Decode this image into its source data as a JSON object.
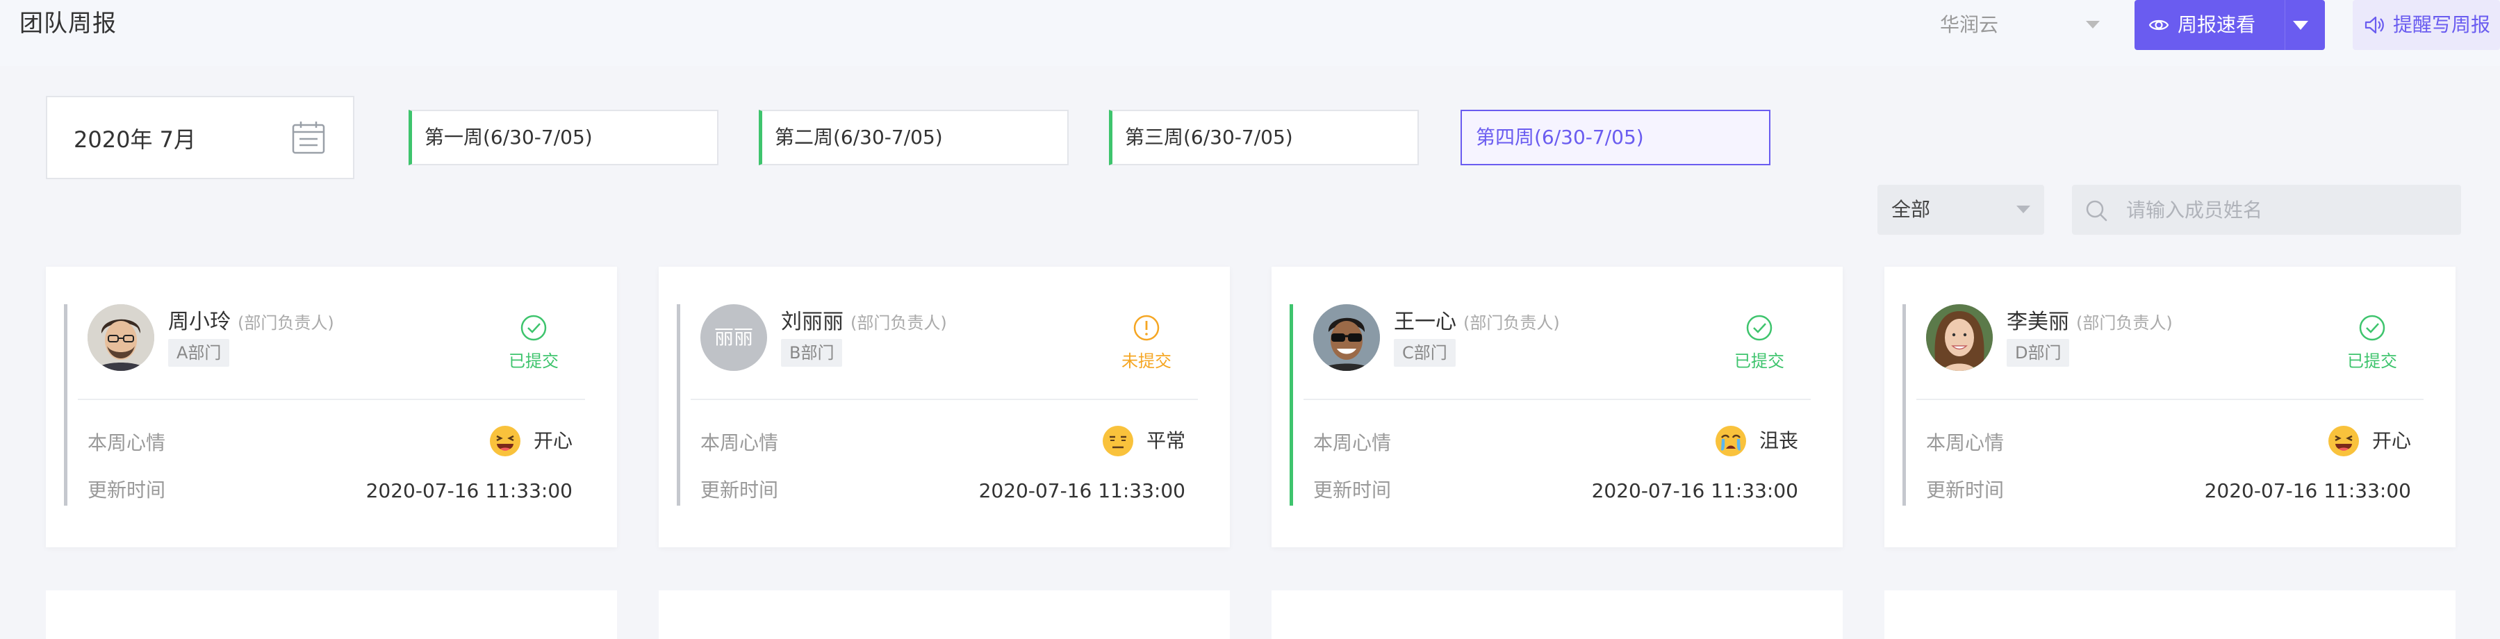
{
  "header": {
    "title": "团队周报",
    "org_select": "华润云",
    "quick_view_label": "周报速看",
    "remind_label": "提醒写周报"
  },
  "month_picker": {
    "value": "2020年   7月"
  },
  "weeks": [
    {
      "label": "第一周(6/30-7/05)",
      "active": false
    },
    {
      "label": "第二周(6/30-7/05)",
      "active": false
    },
    {
      "label": "第三周(6/30-7/05)",
      "active": false
    },
    {
      "label": "第四周(6/30-7/05)",
      "active": true
    }
  ],
  "filters": {
    "scope": "全部",
    "search_placeholder": "请输入成员姓名",
    "search_value": ""
  },
  "labels": {
    "mood": "本周心情",
    "updated": "更新时间"
  },
  "members": [
    {
      "name": "周小玲",
      "role": "(部门负责人)",
      "dept": "A部门",
      "status": "已提交",
      "mood": "开心",
      "updated": "2020-07-16 11:33:00"
    },
    {
      "name": "刘丽丽",
      "role": "(部门负责人)",
      "dept": "B部门",
      "status": "未提交",
      "avatar_text": "丽丽",
      "mood": "平常",
      "updated": "2020-07-16 11:33:00"
    },
    {
      "name": "王一心",
      "role": "(部门负责人)",
      "dept": "C部门",
      "status": "已提交",
      "mood": "沮丧",
      "updated": "2020-07-16 11:33:00"
    },
    {
      "name": "李美丽",
      "role": "(部门负责人)",
      "dept": "D部门",
      "status": "已提交",
      "mood": "开心",
      "updated": "2020-07-16 11:33:00"
    }
  ],
  "colors": {
    "accent": "#6a5cf0",
    "submitted": "#3ec46d",
    "not_submitted": "#f5a623"
  }
}
